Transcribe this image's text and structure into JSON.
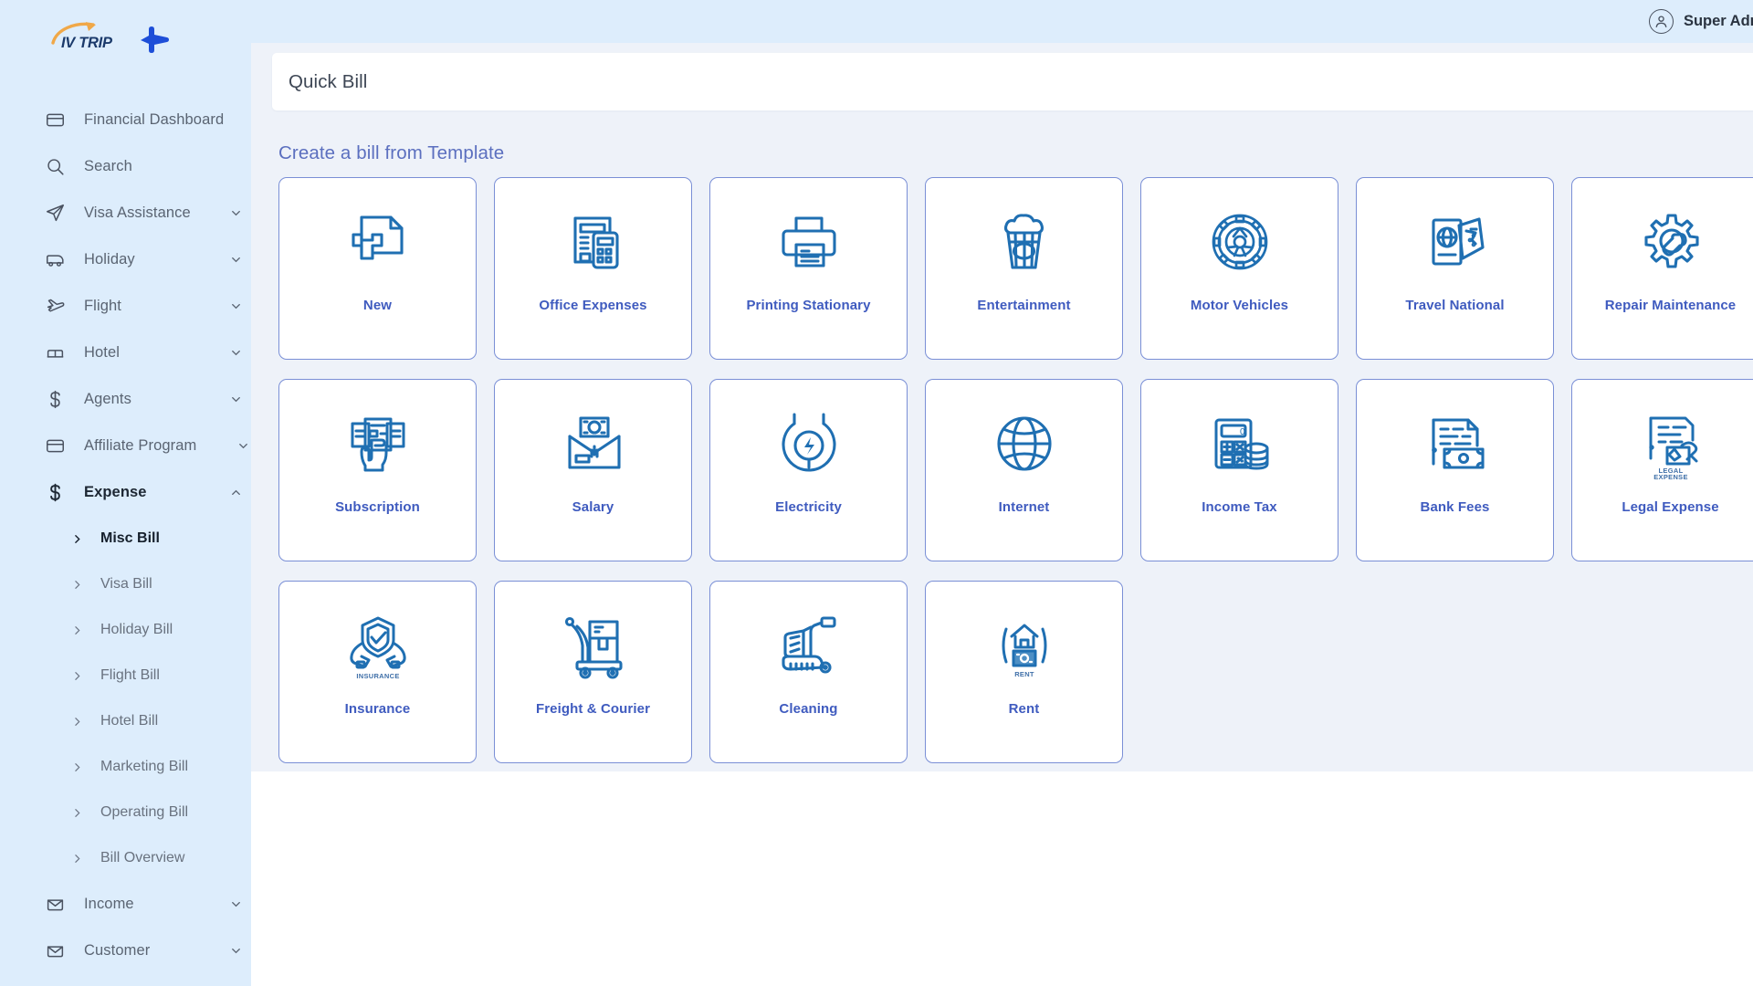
{
  "brand": {
    "name": "IV TRIP",
    "logo_icon": "swoosh-arrow-icon",
    "plane_icon": "airplane-icon"
  },
  "topbar": {
    "user_name": "Super Admin",
    "avatar_icon": "user-avatar-icon"
  },
  "page": {
    "title": "Quick Bill"
  },
  "sidebar": {
    "items": [
      {
        "label": "Financial Dashboard",
        "icon": "card-icon",
        "chevron": "none",
        "active": false
      },
      {
        "label": "Search",
        "icon": "search-icon",
        "chevron": "none",
        "active": false
      },
      {
        "label": "Visa Assistance",
        "icon": "paper-plane-icon",
        "chevron": "down",
        "active": false
      },
      {
        "label": "Holiday",
        "icon": "bus-icon",
        "chevron": "down",
        "active": false
      },
      {
        "label": "Flight",
        "icon": "flight-icon",
        "chevron": "down",
        "active": false
      },
      {
        "label": "Hotel",
        "icon": "bed-icon",
        "chevron": "down",
        "active": false
      },
      {
        "label": "Agents",
        "icon": "dollar-icon",
        "chevron": "down",
        "active": false
      },
      {
        "label": "Affiliate Program",
        "icon": "card-icon",
        "chevron": "down",
        "active": false
      },
      {
        "label": "Expense",
        "icon": "dollar-icon",
        "chevron": "up",
        "active": true
      }
    ],
    "expense_submenu": [
      {
        "label": "Misc Bill",
        "active": true
      },
      {
        "label": "Visa Bill",
        "active": false
      },
      {
        "label": "Holiday Bill",
        "active": false
      },
      {
        "label": "Flight Bill",
        "active": false
      },
      {
        "label": "Hotel Bill",
        "active": false
      },
      {
        "label": "Marketing Bill",
        "active": false
      },
      {
        "label": "Operating Bill",
        "active": false
      },
      {
        "label": "Bill Overview",
        "active": false
      }
    ],
    "tail_items": [
      {
        "label": "Income",
        "icon": "inbox-icon",
        "chevron": "down",
        "active": false
      },
      {
        "label": "Customer",
        "icon": "inbox-icon",
        "chevron": "down",
        "active": false
      }
    ]
  },
  "main": {
    "section_title": "Create a bill from Template",
    "templates": [
      {
        "label": "New",
        "icon": "document-plus-icon",
        "inner_text": ""
      },
      {
        "label": "Office Expenses",
        "icon": "invoice-calculator-icon",
        "inner_text": ""
      },
      {
        "label": "Printing Stationary",
        "icon": "printer-icon",
        "inner_text": ""
      },
      {
        "label": "Entertainment",
        "icon": "popcorn-icon",
        "inner_text": ""
      },
      {
        "label": "Motor Vehicles",
        "icon": "wheel-icon",
        "inner_text": ""
      },
      {
        "label": "Travel National",
        "icon": "passport-ticket-icon",
        "inner_text": ""
      },
      {
        "label": "Repair Maintenance",
        "icon": "gear-wrench-icon",
        "inner_text": ""
      },
      {
        "label": "Subscription",
        "icon": "hand-cards-icon",
        "inner_text": ""
      },
      {
        "label": "Salary",
        "icon": "envelope-money-icon",
        "inner_text": ""
      },
      {
        "label": "Electricity",
        "icon": "plug-bolt-icon",
        "inner_text": ""
      },
      {
        "label": "Internet",
        "icon": "globe-icon",
        "inner_text": ""
      },
      {
        "label": "Income Tax",
        "icon": "calculator-coins-icon",
        "inner_text": ""
      },
      {
        "label": "Bank Fees",
        "icon": "document-banknote-icon",
        "inner_text": ""
      },
      {
        "label": "Legal Expense",
        "icon": "legal-document-icon",
        "inner_text": "LEGAL EXPENSE"
      },
      {
        "label": "Insurance",
        "icon": "shield-hands-icon",
        "inner_text": "INSURANCE"
      },
      {
        "label": "Freight & Courier",
        "icon": "hand-truck-icon",
        "inner_text": ""
      },
      {
        "label": "Cleaning",
        "icon": "vacuum-icon",
        "inner_text": ""
      },
      {
        "label": "Rent",
        "icon": "house-money-icon",
        "inner_text": "RENT"
      }
    ]
  },
  "colors": {
    "sidebar_bg": "#ddedfc",
    "content_bg": "#eef2f9",
    "card_border": "#7a8fd6",
    "label_blue": "#3f5bbf",
    "section_blue": "#5b6fbf",
    "icon_blue": "#1f6fb2"
  }
}
